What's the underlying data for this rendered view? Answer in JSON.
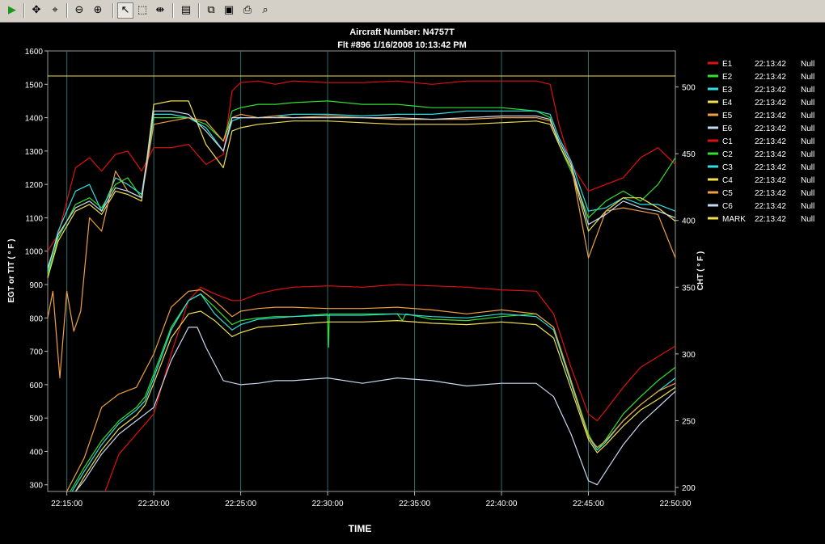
{
  "toolbar": {
    "buttons": [
      {
        "name": "run-icon",
        "glyph": "▶"
      },
      {
        "name": "pan-icon",
        "glyph": "✥"
      },
      {
        "name": "zoom-area-icon",
        "glyph": "⌖"
      },
      {
        "name": "zoom-out-icon",
        "glyph": "⊖"
      },
      {
        "name": "zoom-in-icon",
        "glyph": "⊕"
      },
      {
        "name": "pointer-icon",
        "glyph": "↖"
      },
      {
        "name": "select-box-icon",
        "glyph": "⬚"
      },
      {
        "name": "fit-width-icon",
        "glyph": "⇼"
      },
      {
        "name": "properties-icon",
        "glyph": "▤"
      },
      {
        "name": "copy-icon",
        "glyph": "⧉"
      },
      {
        "name": "save-icon",
        "glyph": "▣"
      },
      {
        "name": "print-icon",
        "glyph": "⎙"
      },
      {
        "name": "print-preview-icon",
        "glyph": "⌕"
      }
    ]
  },
  "chart_data": {
    "type": "line",
    "title": "Aircraft Number: N4757T",
    "subtitle": "Flt #896 1/16/2008 10:13:42 PM",
    "xlabel": "TIME",
    "ylabel": "EGT or TIT ( ° F )",
    "y2label": "CHT ( ° F )",
    "x_ticks": [
      "22:15:00",
      "22:20:00",
      "22:25:00",
      "22:30:00",
      "22:35:00",
      "22:40:00",
      "22:45:00",
      "22:50:00"
    ],
    "xlim_minutes_after_22_00": [
      13.9,
      50
    ],
    "ylim": [
      280,
      1600
    ],
    "y_ticks": [
      300,
      400,
      500,
      600,
      700,
      800,
      900,
      1000,
      1100,
      1200,
      1300,
      1400,
      1500,
      1600
    ],
    "y2lim": [
      197,
      527
    ],
    "y2_ticks": [
      200,
      250,
      300,
      350,
      400,
      450,
      500
    ],
    "reference_line_y": 1525,
    "grid": "vertical",
    "legend_position": "right",
    "legend": [
      {
        "name": "E1",
        "time": "22:13:42",
        "value": "Null",
        "color": "#e01010"
      },
      {
        "name": "E2",
        "time": "22:13:42",
        "value": "Null",
        "color": "#30e030"
      },
      {
        "name": "E3",
        "time": "22:13:42",
        "value": "Null",
        "color": "#30e0e0"
      },
      {
        "name": "E4",
        "time": "22:13:42",
        "value": "Null",
        "color": "#f0e050"
      },
      {
        "name": "E5",
        "time": "22:13:42",
        "value": "Null",
        "color": "#f0a040"
      },
      {
        "name": "E6",
        "time": "22:13:42",
        "value": "Null",
        "color": "#c8d8f0"
      },
      {
        "name": "C1",
        "time": "22:13:42",
        "value": "Null",
        "color": "#e01010"
      },
      {
        "name": "C2",
        "time": "22:13:42",
        "value": "Null",
        "color": "#30e030"
      },
      {
        "name": "C3",
        "time": "22:13:42",
        "value": "Null",
        "color": "#30e0e0"
      },
      {
        "name": "C4",
        "time": "22:13:42",
        "value": "Null",
        "color": "#f0e050"
      },
      {
        "name": "C5",
        "time": "22:13:42",
        "value": "Null",
        "color": "#f0a040"
      },
      {
        "name": "C6",
        "time": "22:13:42",
        "value": "Null",
        "color": "#c8d8f0"
      },
      {
        "name": "MARK",
        "time": "22:13:42",
        "value": "Null",
        "color": "#f0e050"
      }
    ],
    "series": [
      {
        "name": "E1",
        "axis": "left",
        "color": "#e01010",
        "x": [
          13.9,
          14.5,
          15.5,
          16.3,
          17,
          17.8,
          18.5,
          19.3,
          20,
          21,
          22,
          23,
          24,
          24.5,
          25,
          26,
          27,
          28,
          30,
          32,
          34,
          36,
          38,
          40,
          42,
          42.8,
          43.3,
          44,
          45,
          46,
          47,
          48,
          49,
          50
        ],
        "y": [
          1000,
          1050,
          1250,
          1280,
          1240,
          1290,
          1300,
          1240,
          1310,
          1310,
          1320,
          1260,
          1290,
          1480,
          1505,
          1510,
          1500,
          1510,
          1505,
          1505,
          1510,
          1500,
          1510,
          1510,
          1510,
          1500,
          1380,
          1260,
          1180,
          1200,
          1220,
          1280,
          1310,
          1260
        ]
      },
      {
        "name": "E2",
        "axis": "left",
        "color": "#30e030",
        "x": [
          13.9,
          14.5,
          15.5,
          16.3,
          17,
          17.8,
          18.5,
          19.3,
          20,
          21,
          22,
          23,
          24,
          24.5,
          25,
          26,
          27,
          28,
          30,
          32,
          34,
          36,
          38,
          40,
          42,
          42.8,
          43.3,
          44,
          45,
          46,
          47,
          48,
          49,
          50
        ],
        "y": [
          930,
          1040,
          1140,
          1160,
          1130,
          1200,
          1220,
          1160,
          1400,
          1400,
          1400,
          1380,
          1330,
          1420,
          1430,
          1440,
          1440,
          1445,
          1450,
          1440,
          1440,
          1430,
          1430,
          1430,
          1420,
          1400,
          1320,
          1240,
          1100,
          1150,
          1180,
          1150,
          1200,
          1280
        ]
      },
      {
        "name": "E3",
        "axis": "left",
        "color": "#30e0e0",
        "x": [
          13.9,
          14.5,
          15.5,
          16.3,
          17,
          17.8,
          18.5,
          19.3,
          20,
          21,
          22,
          23,
          24,
          24.5,
          25,
          26,
          27,
          28,
          30,
          32,
          34,
          36,
          38,
          40,
          42,
          42.8,
          43.3,
          44,
          45,
          46,
          47,
          48,
          49,
          50
        ],
        "y": [
          940,
          1060,
          1180,
          1200,
          1120,
          1220,
          1200,
          1170,
          1410,
          1410,
          1400,
          1370,
          1300,
          1390,
          1400,
          1400,
          1405,
          1410,
          1410,
          1405,
          1410,
          1410,
          1420,
          1420,
          1420,
          1410,
          1340,
          1270,
          1120,
          1130,
          1160,
          1140,
          1140,
          1120
        ]
      },
      {
        "name": "E4",
        "axis": "left",
        "color": "#f0e050",
        "x": [
          13.9,
          14.5,
          15.5,
          16.3,
          17,
          17.8,
          18.5,
          19.3,
          20,
          21,
          22,
          23,
          24,
          24.5,
          25,
          26,
          27,
          28,
          30,
          32,
          34,
          36,
          38,
          40,
          42,
          42.8,
          43.3,
          44,
          45,
          46,
          47,
          48,
          49,
          50
        ],
        "y": [
          920,
          1030,
          1120,
          1140,
          1110,
          1180,
          1170,
          1150,
          1440,
          1450,
          1450,
          1320,
          1250,
          1360,
          1370,
          1380,
          1385,
          1390,
          1390,
          1385,
          1380,
          1380,
          1380,
          1385,
          1390,
          1380,
          1320,
          1250,
          1060,
          1120,
          1160,
          1160,
          1130,
          1090
        ]
      },
      {
        "name": "E5",
        "axis": "left",
        "color": "#f0a040",
        "x": [
          13.9,
          14.2,
          14.6,
          15,
          15.4,
          15.8,
          16.3,
          17,
          17.8,
          18.5,
          19.3,
          20,
          21,
          22,
          23,
          24,
          24.5,
          25,
          26,
          27,
          28,
          30,
          32,
          34,
          36,
          38,
          40,
          42,
          42.8,
          43.3,
          44,
          45,
          46,
          47,
          48,
          49,
          50
        ],
        "y": [
          800,
          880,
          620,
          880,
          760,
          820,
          1100,
          1060,
          1240,
          1180,
          1160,
          1380,
          1390,
          1400,
          1390,
          1330,
          1400,
          1410,
          1400,
          1405,
          1400,
          1405,
          1400,
          1395,
          1395,
          1395,
          1400,
          1400,
          1390,
          1330,
          1260,
          980,
          1120,
          1130,
          1120,
          1110,
          980
        ]
      },
      {
        "name": "E6",
        "axis": "left",
        "color": "#c8d8f0",
        "x": [
          13.9,
          14.5,
          15.5,
          16.3,
          17,
          17.8,
          18.5,
          19.3,
          20,
          21,
          22,
          23,
          24,
          24.5,
          25,
          26,
          27,
          28,
          30,
          32,
          34,
          36,
          38,
          40,
          42,
          42.8,
          43.3,
          44,
          45,
          46,
          47,
          48,
          49,
          50
        ],
        "y": [
          950,
          1050,
          1130,
          1150,
          1120,
          1190,
          1180,
          1160,
          1420,
          1420,
          1410,
          1360,
          1300,
          1400,
          1400,
          1400,
          1400,
          1400,
          1400,
          1400,
          1400,
          1395,
          1400,
          1405,
          1405,
          1395,
          1330,
          1260,
          1080,
          1110,
          1150,
          1130,
          1120,
          1100
        ]
      },
      {
        "name": "C1",
        "axis": "right",
        "color": "#e01010",
        "x": [
          17.2,
          18,
          19,
          20,
          21,
          22,
          22.7,
          23.5,
          24.5,
          25,
          26,
          27,
          28,
          30,
          32,
          34,
          36,
          38,
          40,
          42,
          43,
          44,
          45,
          45.5,
          46,
          47,
          48,
          49,
          50
        ],
        "y": [
          197,
          225,
          240,
          255,
          300,
          340,
          350,
          345,
          340,
          340,
          345,
          348,
          350,
          351,
          350,
          352,
          351,
          350,
          348,
          347,
          330,
          290,
          255,
          250,
          258,
          275,
          290,
          298,
          306
        ]
      },
      {
        "name": "C2",
        "axis": "right",
        "color": "#30e030",
        "x": [
          15.2,
          16,
          17,
          18,
          19,
          19.5,
          20,
          21,
          22,
          22.7,
          23.5,
          24.5,
          25,
          26,
          27,
          28,
          30,
          30.05,
          30.1,
          32,
          34,
          34.3,
          34.5,
          36,
          38,
          40,
          42,
          43,
          44,
          45,
          45.5,
          46,
          47,
          48,
          49,
          50
        ],
        "y": [
          197,
          215,
          235,
          250,
          260,
          268,
          285,
          320,
          340,
          345,
          335,
          322,
          325,
          327,
          328,
          328,
          330,
          305,
          330,
          330,
          330,
          325,
          330,
          326,
          325,
          328,
          330,
          320,
          280,
          240,
          228,
          236,
          255,
          268,
          280,
          290
        ]
      },
      {
        "name": "C3",
        "axis": "right",
        "color": "#30e0e0",
        "x": [
          15.3,
          16,
          17,
          18,
          19,
          19.5,
          20,
          21,
          22,
          22.7,
          23.5,
          24.5,
          25,
          26,
          27,
          28,
          30,
          32,
          34,
          36,
          38,
          40,
          42,
          43,
          44,
          45,
          45.5,
          46,
          47,
          48,
          49,
          50
        ],
        "y": [
          197,
          212,
          232,
          248,
          258,
          265,
          282,
          318,
          340,
          345,
          330,
          318,
          322,
          326,
          327,
          328,
          329,
          329,
          330,
          328,
          327,
          330,
          328,
          318,
          278,
          238,
          228,
          234,
          250,
          262,
          272,
          282
        ]
      },
      {
        "name": "C4",
        "axis": "right",
        "color": "#f0e050",
        "x": [
          15.5,
          16,
          17,
          18,
          19,
          19.5,
          20,
          21,
          22,
          22.7,
          23.5,
          24.5,
          25,
          26,
          27,
          28,
          30,
          32,
          34,
          36,
          38,
          40,
          42,
          43,
          44,
          45,
          45.5,
          46,
          47,
          48,
          49,
          50
        ],
        "y": [
          197,
          208,
          228,
          244,
          254,
          262,
          278,
          312,
          330,
          332,
          325,
          313,
          316,
          320,
          321,
          322,
          324,
          324,
          325,
          323,
          322,
          324,
          322,
          312,
          274,
          236,
          226,
          232,
          246,
          258,
          266,
          275
        ]
      },
      {
        "name": "C5",
        "axis": "right",
        "color": "#f0a040",
        "x": [
          15,
          16,
          17,
          18,
          19,
          20,
          21,
          22,
          22.7,
          23.5,
          24.5,
          25,
          26,
          27,
          28,
          30,
          32,
          34,
          36,
          38,
          40,
          42,
          43,
          44,
          45,
          45.5,
          46,
          47,
          48,
          49,
          50
        ],
        "y": [
          197,
          222,
          260,
          270,
          275,
          300,
          335,
          347,
          348,
          340,
          328,
          332,
          334,
          335,
          335,
          334,
          334,
          335,
          333,
          330,
          333,
          330,
          320,
          280,
          238,
          230,
          235,
          250,
          262,
          272,
          278
        ]
      },
      {
        "name": "C6",
        "axis": "right",
        "color": "#c8d8f0",
        "x": [
          15.5,
          16,
          17,
          18,
          19,
          20,
          21,
          22,
          22.5,
          23,
          24,
          25,
          26,
          27,
          28,
          30,
          32,
          34,
          36,
          38,
          40,
          42,
          43,
          44,
          45,
          45.5,
          46,
          47,
          48,
          49,
          50
        ],
        "y": [
          197,
          205,
          225,
          240,
          250,
          260,
          295,
          320,
          320,
          305,
          280,
          277,
          278,
          280,
          280,
          282,
          278,
          282,
          280,
          276,
          278,
          278,
          268,
          240,
          205,
          202,
          212,
          232,
          248,
          260,
          272
        ]
      }
    ]
  }
}
